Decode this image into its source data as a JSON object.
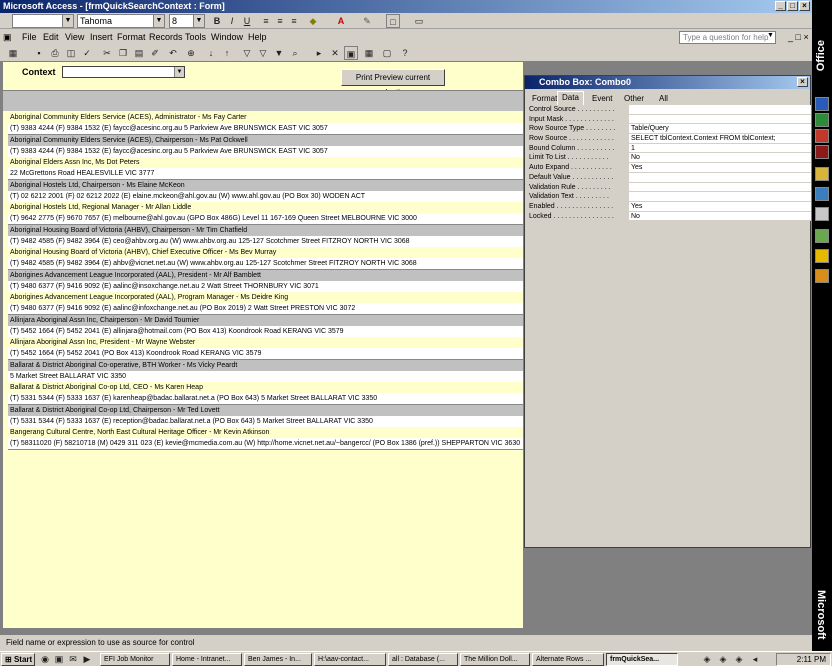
{
  "window": {
    "title": "Microsoft Access - [frmQuickSearchContext : Form]"
  },
  "format_toolbar": {
    "object_combo": "",
    "font_name": "Tahoma",
    "font_size": "8",
    "bold": "B",
    "italic": "I",
    "underline": "U"
  },
  "menu": {
    "items": [
      "File",
      "Edit",
      "View",
      "Insert",
      "Format",
      "Records",
      "Tools",
      "Window",
      "Help"
    ],
    "help_placeholder": "Type a question for help"
  },
  "form": {
    "context_label": "Context",
    "context_value": "",
    "print_button": "Print Preview current selection",
    "records": [
      {
        "line1": "Aboriginal Community Elders Service (ACES), Administrator - Ms Fay Carter",
        "line2": "(T) 9383 4244 (F) 9384 1532 (E) faycc@acesinc.org.au  5 Parkview Ave BRUNSWICK EAST VIC 3057",
        "shaded": false
      },
      {
        "line1": "Aboriginal Community Elders Service (ACES), Chairperson - Ms Pat Ockwell",
        "line2": "(T) 9383 4244 (F) 9384 1532 (E) faycc@acesinc.org.au  5 Parkview Ave BRUNSWICK EAST VIC 3057",
        "shaded": true
      },
      {
        "line1": "Aboriginal Elders Assn Inc, Ms Dot Peters",
        "line2": " 22 McGrettons Road HEALESVILLE VIC 3777",
        "shaded": false
      },
      {
        "line1": "Aboriginal Hostels Ltd, Chairperson - Ms Elaine McKeon",
        "line2": "(T) 02 6212 2001 (F) 02 6212 2022 (E) elaine.mckeon@ahl.gov.au (W) www.ahl.gov.au  (PO Box 30)  WODEN ACT",
        "shaded": true
      },
      {
        "line1": "Aboriginal Hostels Ltd, Regional Manager - Mr Allan Liddle",
        "line2": "(T) 9642 2775 (F) 9670 7657 (E) melbourne@ahl.gov.au  (GPO Box  486G) Level 11 167-169 Queen Street MELBOURNE VIC 3000",
        "shaded": false
      },
      {
        "line1": "Aboriginal Housing Board of Victoria (AHBV), Chairperson - Mr Tim Chatfield",
        "line2": "(T) 9482 4585 (F) 9482 3964 (E) ceo@ahbv.org.au (W) www.ahbv.org.au  125-127 Scotchmer Street FITZROY NORTH VIC 3068",
        "shaded": true
      },
      {
        "line1": "Aboriginal Housing Board of Victoria (AHBV), Chief Executive Officer - Ms Bev Murray",
        "line2": "(T)  9482 4585 (F) 9482 3964 (E) ahbv@vicnet.net.au (W) www.ahbv.org.au  125-127 Scotchmer Street FITZROY NORTH VIC 3068",
        "shaded": false
      },
      {
        "line1": "Aborigines Advancement League Incorporated (AAL), President - Mr Alf Bamblett",
        "line2": "(T) 9480 6377 (F) 9416 9092 (E) aalinc@insoxchange.net.au  2 Watt Street THORNBURY VIC 3071",
        "shaded": true
      },
      {
        "line1": "Aborigines Advancement League Incorporated (AAL), Program Manager - Ms Deidre King",
        "line2": "(T) 9480 6377 (F) 9416 9092 (E) aalinc@infoxchange.net.au  (PO Box 2019) 2 Watt Street PRESTON VIC 3072",
        "shaded": false
      },
      {
        "line1": "Allinjara Aboriginal Assn Inc, Chairperson - Mr David Tournier",
        "line2": "(T) 5452 1664 (F) 5452 2041 (E) allinjara@hotmail.com  (PO Box 413) Koondrook Road KERANG VIC 3579",
        "shaded": true
      },
      {
        "line1": "Allinjara Aboriginal Assn Inc, President - Mr Wayne Webster",
        "line2": "(T) 5452 1664 (F) 5452 2041  (PO Box 413) Koondrook Road KERANG VIC 3579",
        "shaded": false
      },
      {
        "line1": "Ballarat & District Aboriginal Co-operative, BTH Worker - Ms Vicky Peardt",
        "line2": " 5 Market Street BALLARAT VIC 3350",
        "shaded": true
      },
      {
        "line1": "Ballarat & District Aboriginal Co-op Ltd, CEO - Ms Karen Heap",
        "line2": "(T) 5331 5344 (F) 5333 1637 (E) karenheap@badac.ballarat.net.a  (PO Box 643) 5 Market Street BALLARAT VIC 3350",
        "shaded": false
      },
      {
        "line1": "Ballarat & District Aboriginal Co-op Ltd, Chairperson - Mr Ted Lovett",
        "line2": "(T) 5331 5344 (F) 5333 1637 (E) reception@badac.ballarat.net.a  (PO Box 643) 5 Market Street BALLARAT VIC 3350",
        "shaded": true
      },
      {
        "line1": "Bangerang Cultural Centre, North East Cultural Heritage Officer - Mr Kevin Atkinson",
        "line2": "(T) 58311020 (F) 58210718 (M) 0429 311 023 (E) kevie@mcmedia.com.au (W) http://home.vicnet.net.au/~bangercc/  (PO Box 1386  (pref.))  SHEPPARTON VIC 3630",
        "shaded": false
      }
    ]
  },
  "property_sheet": {
    "title": "Combo Box: Combo0",
    "tabs": [
      "Format",
      "Data",
      "Event",
      "Other",
      "All"
    ],
    "active_tab": "Data",
    "properties": [
      {
        "name": "Control Source . . . . . . . . . .",
        "value": ""
      },
      {
        "name": "Input Mask . . . . . . . . . . . . .",
        "value": ""
      },
      {
        "name": "Row Source Type . . . . . . . .",
        "value": "Table/Query"
      },
      {
        "name": "Row Source . . . . . . . . . . . .",
        "value": "SELECT tblContext.Context FROM tblContext;"
      },
      {
        "name": "Bound Column . . . . . . . . . .",
        "value": "1"
      },
      {
        "name": "Limit To List . . . . . . . . . . .",
        "value": "No"
      },
      {
        "name": "Auto Expand . . . . . . . . . . .",
        "value": "Yes"
      },
      {
        "name": "Default Value . . . . . . . . . . .",
        "value": ""
      },
      {
        "name": "Validation Rule . . . . . . . . .",
        "value": ""
      },
      {
        "name": "Validation Text . . . . . . . . .",
        "value": ""
      },
      {
        "name": "Enabled . . . . . . . . . . . . . . .",
        "value": "Yes"
      },
      {
        "name": "Locked . . . . . . . . . . . . . . . .",
        "value": "No"
      }
    ]
  },
  "status": {
    "text": "Field name or expression to use as source for control"
  },
  "office_bar": {
    "top_label": "Office",
    "bottom_label": "Microsoft"
  },
  "taskbar": {
    "start": "Start",
    "tasks": [
      "EFI Job Monitor",
      "Home - Intranet...",
      "Ben James - In...",
      "H:\\aav-contact...",
      "all : Database (...",
      "The Million Doll...",
      "Alternate Rows ...",
      "frmQuickSea..."
    ],
    "active_task": 7,
    "clock": "2:11 PM"
  }
}
